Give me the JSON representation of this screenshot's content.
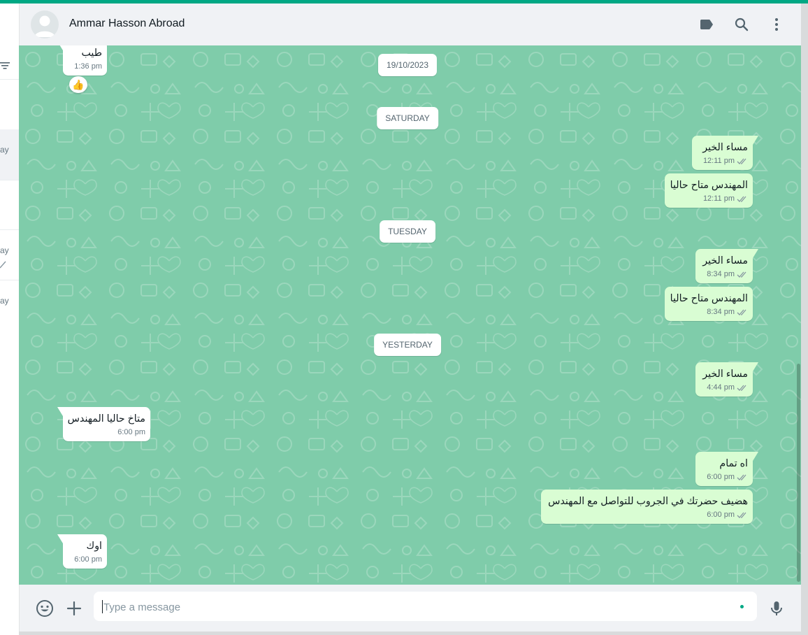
{
  "theme": {
    "accent": "#00a884",
    "chat_bg": "#7fccaa",
    "outgoing_bubble": "#d9fdd3",
    "incoming_bubble": "#ffffff",
    "read_ticks": "#8696a0"
  },
  "sidebar": {
    "fragments": [
      "ay",
      "ay",
      "ay"
    ]
  },
  "header": {
    "contact_name": "Ammar Hasson Abroad",
    "avatar_icon": "default-avatar-icon",
    "icons": [
      "label-icon",
      "search-icon",
      "menu-dots-icon"
    ]
  },
  "conversation": {
    "dates": {
      "d1": "19/10/2023",
      "d2": "SATURDAY",
      "d3": "TUESDAY",
      "d4": "YESTERDAY"
    },
    "messages": [
      {
        "dir": "in",
        "text": "طيب",
        "time": "1:36 pm",
        "reaction": "👍"
      },
      {
        "dir": "out",
        "text": "مساء الخير",
        "time": "12:11 pm",
        "status": "read"
      },
      {
        "dir": "out",
        "text": "المهندس متاح حاليا",
        "time": "12:11 pm",
        "status": "read"
      },
      {
        "dir": "out",
        "text": "مساء الخير",
        "time": "8:34 pm",
        "status": "read"
      },
      {
        "dir": "out",
        "text": "المهندس متاح حاليا",
        "time": "8:34 pm",
        "status": "read"
      },
      {
        "dir": "out",
        "text": "مساء الخير",
        "time": "4:44 pm",
        "status": "read"
      },
      {
        "dir": "in",
        "text": "متاخ حاليا المهندس",
        "time": "6:00 pm"
      },
      {
        "dir": "out",
        "text": "اه تمام",
        "time": "6:00 pm",
        "status": "read"
      },
      {
        "dir": "out",
        "text": "هضيف حضرتك في الجروب للتواصل مع المهندس",
        "time": "6:00 pm",
        "status": "read"
      },
      {
        "dir": "in",
        "text": "اوك",
        "time": "6:00 pm"
      }
    ]
  },
  "composer": {
    "placeholder": "Type a message",
    "value": "",
    "icons": [
      "emoji-icon",
      "attach-plus-icon",
      "microphone-icon"
    ]
  }
}
